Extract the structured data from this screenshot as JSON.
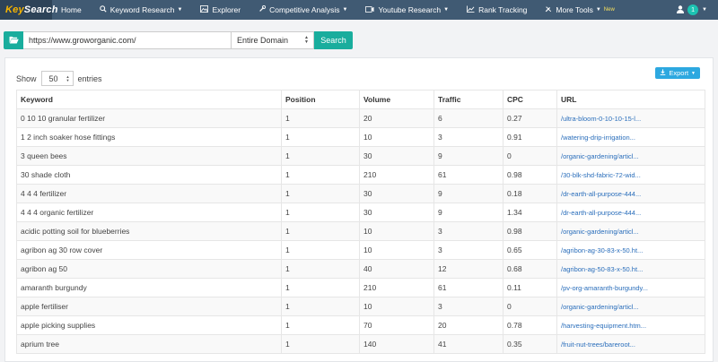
{
  "app": {
    "logo_part1": "Key",
    "logo_part2": "Search"
  },
  "nav": {
    "items": [
      {
        "label": "Home",
        "icon": "",
        "has_caret": false
      },
      {
        "label": "Keyword Research",
        "icon": "search-icon",
        "has_caret": true
      },
      {
        "label": "Explorer",
        "icon": "image-icon",
        "has_caret": false
      },
      {
        "label": "Competitive Analysis",
        "icon": "wrench-icon",
        "has_caret": true
      },
      {
        "label": "Youtube Research",
        "icon": "video-icon",
        "has_caret": true
      },
      {
        "label": "Rank Tracking",
        "icon": "line-chart-icon",
        "has_caret": false
      },
      {
        "label": "More Tools",
        "icon": "tools-icon",
        "has_caret": true,
        "tag": "New"
      }
    ],
    "user_badge": "1"
  },
  "search": {
    "url_value": "https://www.groworganic.com/",
    "scope_value": "Entire Domain",
    "search_label": "Search"
  },
  "table_controls": {
    "show_label": "Show",
    "entries_value": "50",
    "entries_label": "entries",
    "export_label": "Export"
  },
  "table": {
    "columns": [
      "Keyword",
      "Position",
      "Volume",
      "Traffic",
      "CPC",
      "URL"
    ],
    "rows": [
      [
        "0 10 10 granular fertilizer",
        "1",
        "20",
        "6",
        "0.27",
        "/ultra-bloom-0-10-10-15-l..."
      ],
      [
        "1 2 inch soaker hose fittings",
        "1",
        "10",
        "3",
        "0.91",
        "/watering-drip-irrigation..."
      ],
      [
        "3 queen bees",
        "1",
        "30",
        "9",
        "0",
        "/organic-gardening/articl..."
      ],
      [
        "30 shade cloth",
        "1",
        "210",
        "61",
        "0.98",
        "/30-blk-shd-fabric-72-wid..."
      ],
      [
        "4 4 4 fertilizer",
        "1",
        "30",
        "9",
        "0.18",
        "/dr-earth-all-purpose-444..."
      ],
      [
        "4 4 4 organic fertilizer",
        "1",
        "30",
        "9",
        "1.34",
        "/dr-earth-all-purpose-444..."
      ],
      [
        "acidic potting soil for blueberries",
        "1",
        "10",
        "3",
        "0.98",
        "/organic-gardening/articl..."
      ],
      [
        "agribon ag 30 row cover",
        "1",
        "10",
        "3",
        "0.65",
        "/agribon-ag-30-83-x-50.ht..."
      ],
      [
        "agribon ag 50",
        "1",
        "40",
        "12",
        "0.68",
        "/agribon-ag-50-83-x-50.ht..."
      ],
      [
        "amaranth burgundy",
        "1",
        "210",
        "61",
        "0.11",
        "/pv-org-amaranth-burgundy..."
      ],
      [
        "apple fertiliser",
        "1",
        "10",
        "3",
        "0",
        "/organic-gardening/articl..."
      ],
      [
        "apple picking supplies",
        "1",
        "70",
        "20",
        "0.78",
        "/harvesting-equipment.htm..."
      ],
      [
        "aprium tree",
        "1",
        "140",
        "41",
        "0.35",
        "/fruit-nut-trees/bareroot..."
      ]
    ]
  },
  "colors": {
    "nav_bg": "#405a73",
    "accent": "#19ad9d",
    "export": "#2da8e0",
    "link": "#2a6ebb",
    "new_tag": "#f7e05c"
  }
}
